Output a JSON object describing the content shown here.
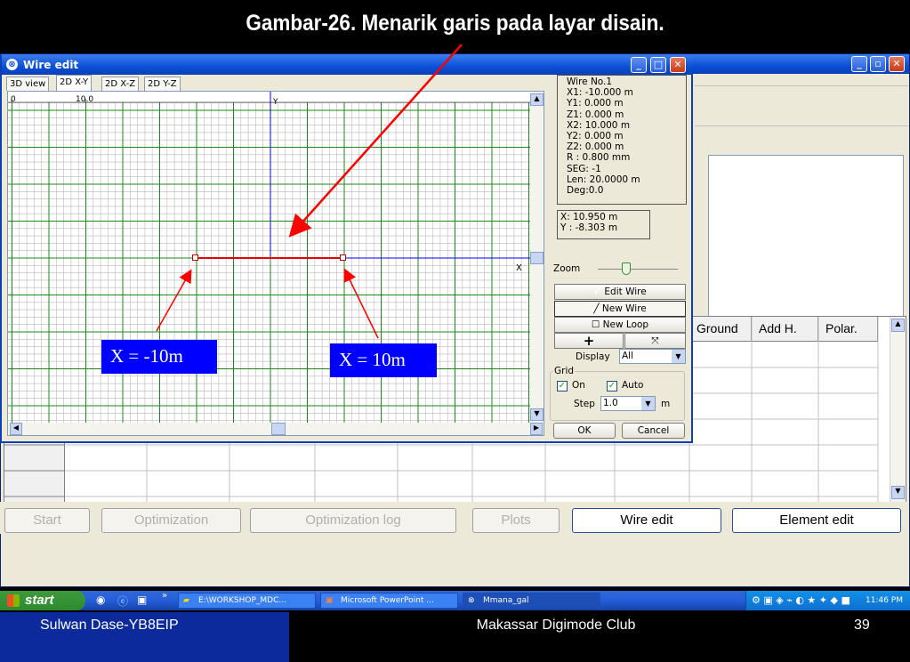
{
  "slide": {
    "title": "Gambar-26. Menarik garis pada layar disain.",
    "footer_left": "Sulwan Dase-YB8EIP",
    "footer_center": "Makassar Digimode Club",
    "page_number": "39"
  },
  "dialog": {
    "title": "Wire edit",
    "tabs": [
      "3D view",
      "2D X-Y",
      "2D X-Z",
      "2D Y-Z"
    ],
    "selected_tab": "2D X-Y",
    "ruler": {
      "zero": "0",
      "ten": "10.0"
    },
    "axis_y": "Y",
    "axis_x": "X",
    "label_left": "X = -10m",
    "label_right": "X = 10m",
    "wire_info": [
      "Wire No.1",
      "X1: -10.000 m",
      "Y1: 0.000 m",
      "Z1: 0.000 m",
      "X2: 10.000 m",
      "Y2: 0.000 m",
      "Z2: 0.000 m",
      "R : 0.800 mm",
      "SEG: -1",
      "Len: 20.0000 m",
      "Deg:0.0"
    ],
    "cursor": [
      "X: 10.950 m",
      "Y : -8.303 m"
    ],
    "zoom_label": "Zoom",
    "edit_wire": "Edit Wire",
    "new_wire": "New Wire",
    "new_loop": "New Loop",
    "plus": "+",
    "fit": "⤧",
    "display_label": "Display",
    "display_value": "All",
    "grid_label": "Grid",
    "grid_on": "On",
    "grid_auto": "Auto",
    "step_label": "Step",
    "step_value": "1.0",
    "step_unit": "m",
    "ok": "OK",
    "cancel": "Cancel"
  },
  "table": {
    "headers": [
      "Ground",
      "Add H.",
      "Polar."
    ]
  },
  "bottom_tabs": [
    "Start",
    "Optimization",
    "Optimization log",
    "Plots",
    "Wire edit",
    "Element edit"
  ],
  "taskbar": {
    "start": "start",
    "tasks": [
      "E:\\WORKSHOP_MDC...",
      "Microsoft PowerPoint ...",
      "Mmana_gal"
    ],
    "clock": "11:46 PM"
  }
}
